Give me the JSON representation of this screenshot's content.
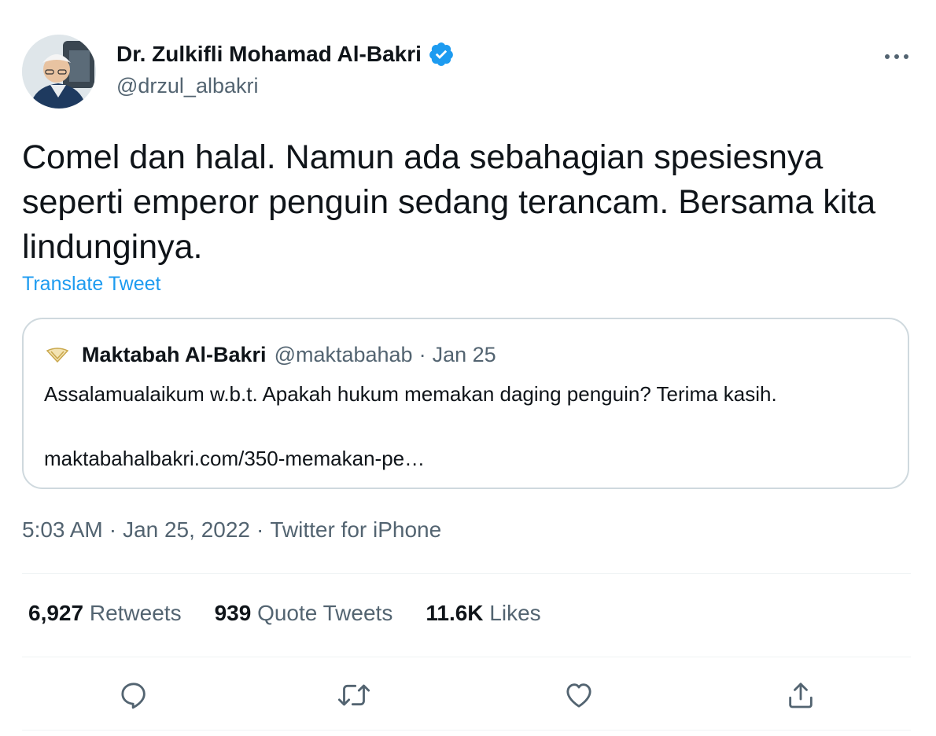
{
  "author": {
    "name": "Dr. Zulkifli Mohamad Al-Bakri",
    "handle": "@drzul_albakri",
    "verified": true
  },
  "tweet": {
    "text": "Comel dan halal. Namun ada sebahagian spesiesnya seperti emperor penguin sedang terancam. Bersama kita lindunginya.",
    "translate_label": "Translate Tweet"
  },
  "quoted_tweet": {
    "name": "Maktabah Al-Bakri",
    "handle": "@maktabahab",
    "separator": "·",
    "date": "Jan 25",
    "text": "Assalamualaikum w.b.t. Apakah hukum memakan daging penguin? Terima kasih.",
    "link": "maktabahalbakri.com/350-memakan-pe…"
  },
  "meta": {
    "time": "5:03 AM",
    "date": "Jan 25, 2022",
    "source": "Twitter for iPhone",
    "separator": "·"
  },
  "stats": {
    "retweets_count": "6,927",
    "retweets_label": "Retweets",
    "quotes_count": "939",
    "quotes_label": "Quote Tweets",
    "likes_count": "11.6K",
    "likes_label": "Likes"
  },
  "icons": {
    "reply": "reply-icon",
    "retweet": "retweet-icon",
    "like": "heart-icon",
    "share": "share-icon",
    "more": "more-icon",
    "verified": "verified-badge-icon"
  },
  "colors": {
    "link": "#1d9bf0",
    "secondary_text": "#536471",
    "primary_text": "#0f1419",
    "border": "#cfd9de"
  }
}
